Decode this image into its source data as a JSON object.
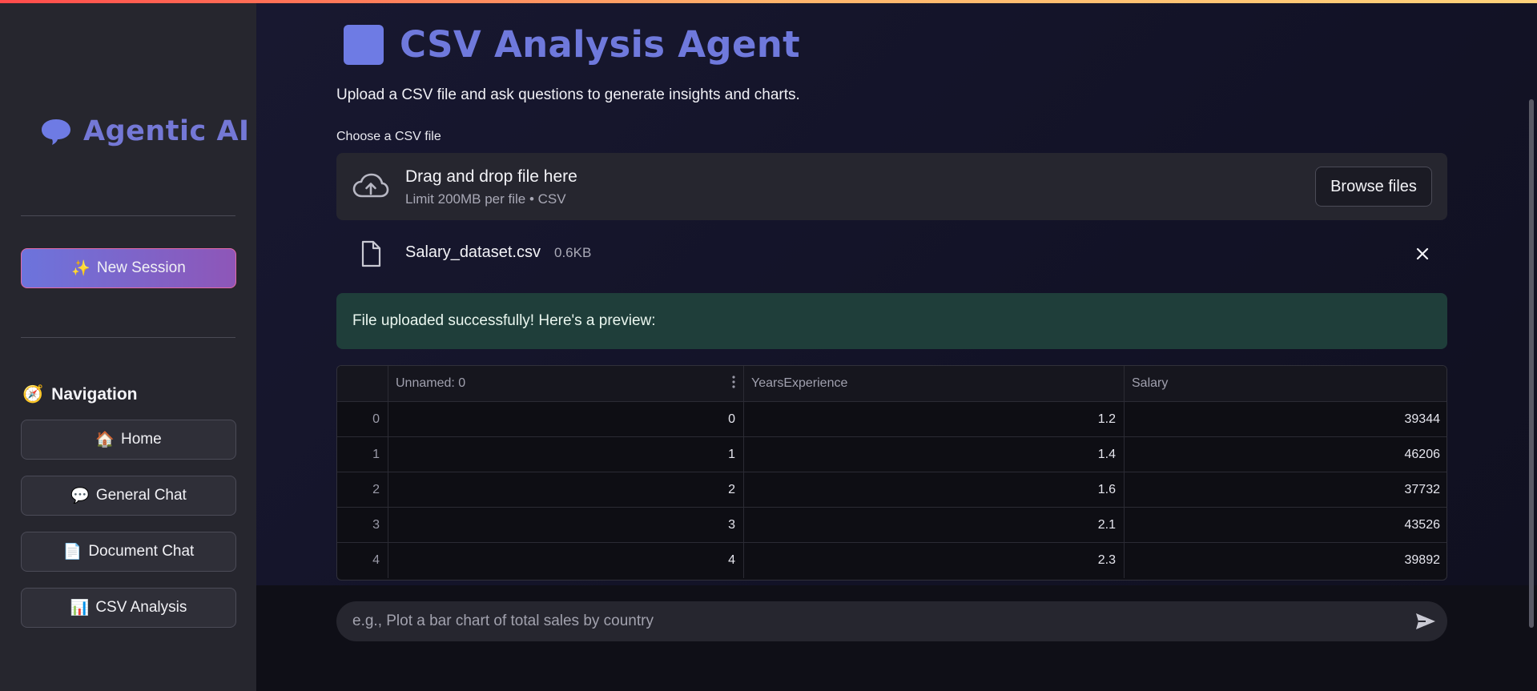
{
  "sidebar": {
    "brand": {
      "emoji": "🗨",
      "title": "Agentic AI"
    },
    "new_session": {
      "emoji": "✨",
      "label": "New Session"
    },
    "navigation": {
      "emoji": "🧭",
      "title": "Navigation",
      "items": [
        {
          "emoji": "🏠",
          "label": "Home"
        },
        {
          "emoji": "💬",
          "label": "General Chat"
        },
        {
          "emoji": "📄",
          "label": "Document Chat"
        },
        {
          "emoji": "📊",
          "label": "CSV Analysis"
        }
      ]
    }
  },
  "main": {
    "title": "CSV Analysis Agent",
    "subtitle": "Upload a CSV file and ask questions to generate insights and charts.",
    "uploader": {
      "label": "Choose a CSV file",
      "drop_text": "Drag and drop file here",
      "limit_text": "Limit 200MB per file • CSV",
      "browse_label": "Browse files"
    },
    "uploaded_file": {
      "name": "Salary_dataset.csv",
      "size": "0.6KB"
    },
    "success_message": "File uploaded successfully! Here's a preview:",
    "table": {
      "columns": [
        "",
        "Unnamed: 0",
        "YearsExperience",
        "Salary"
      ],
      "rows": [
        [
          "0",
          "0",
          "1.2",
          "39344"
        ],
        [
          "1",
          "1",
          "1.4",
          "46206"
        ],
        [
          "2",
          "2",
          "1.6",
          "37732"
        ],
        [
          "3",
          "3",
          "2.1",
          "43526"
        ],
        [
          "4",
          "4",
          "2.3",
          "39892"
        ]
      ]
    },
    "chat": {
      "placeholder": "e.g., Plot a bar chart of total sales by country"
    }
  },
  "colors": {
    "accent": "#6f79dc",
    "success_bg": "#1f3e3a",
    "sidebar_bg": "#26262e",
    "new_session_border": "#e36aa6"
  }
}
